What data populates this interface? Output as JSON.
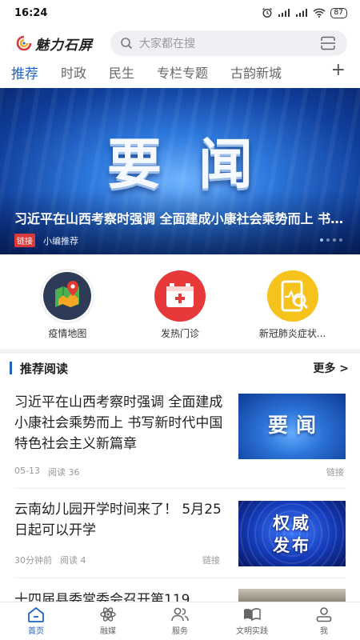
{
  "status": {
    "time": "16:24",
    "battery": "87"
  },
  "header": {
    "logo_text": "魅力石屏",
    "search_placeholder": "大家都在搜"
  },
  "tabs": [
    {
      "label": "推荐",
      "active": true
    },
    {
      "label": "时政"
    },
    {
      "label": "民生"
    },
    {
      "label": "专栏专题"
    },
    {
      "label": "古韵新城"
    }
  ],
  "banner": {
    "big_text": "要闻",
    "title": "习近平在山西考察时强调 全面建成小康社会乘势而上 书写新时代中国特色社会主义新篇章",
    "tag": "链接",
    "source": "小编推荐"
  },
  "quick": [
    {
      "label": "疫情地图",
      "icon": "map-icon"
    },
    {
      "label": "发热门诊",
      "icon": "medical-kit-icon"
    },
    {
      "label": "新冠肺炎症状...",
      "icon": "symptom-check-icon"
    }
  ],
  "section": {
    "title": "推荐阅读",
    "more": "更多 >"
  },
  "news": [
    {
      "title": "习近平在山西考察时强调 全面建成小康社会乘势而上 书写新时代中国特色社会主义新篇章",
      "date": "05-13",
      "reads": "阅读 36",
      "kind": "链接",
      "thumb_text": "要闻"
    },
    {
      "title": "云南幼儿园开学时间来了！ 5月25日起可以开学",
      "date": "30分钟前",
      "reads": "阅读 4",
      "kind": "链接",
      "thumb_line1": "权威",
      "thumb_line2": "发布"
    },
    {
      "title": "十四届县委常委会召开第119"
    }
  ],
  "nav": [
    {
      "label": "首页",
      "icon": "home-icon",
      "active": true
    },
    {
      "label": "融媒",
      "icon": "atom-icon"
    },
    {
      "label": "服务",
      "icon": "users-icon"
    },
    {
      "label": "文明实践",
      "icon": "book-icon"
    },
    {
      "label": "我",
      "icon": "person-icon"
    }
  ],
  "colors": {
    "accent": "#1f63c6",
    "tag_red": "#d9393a"
  }
}
